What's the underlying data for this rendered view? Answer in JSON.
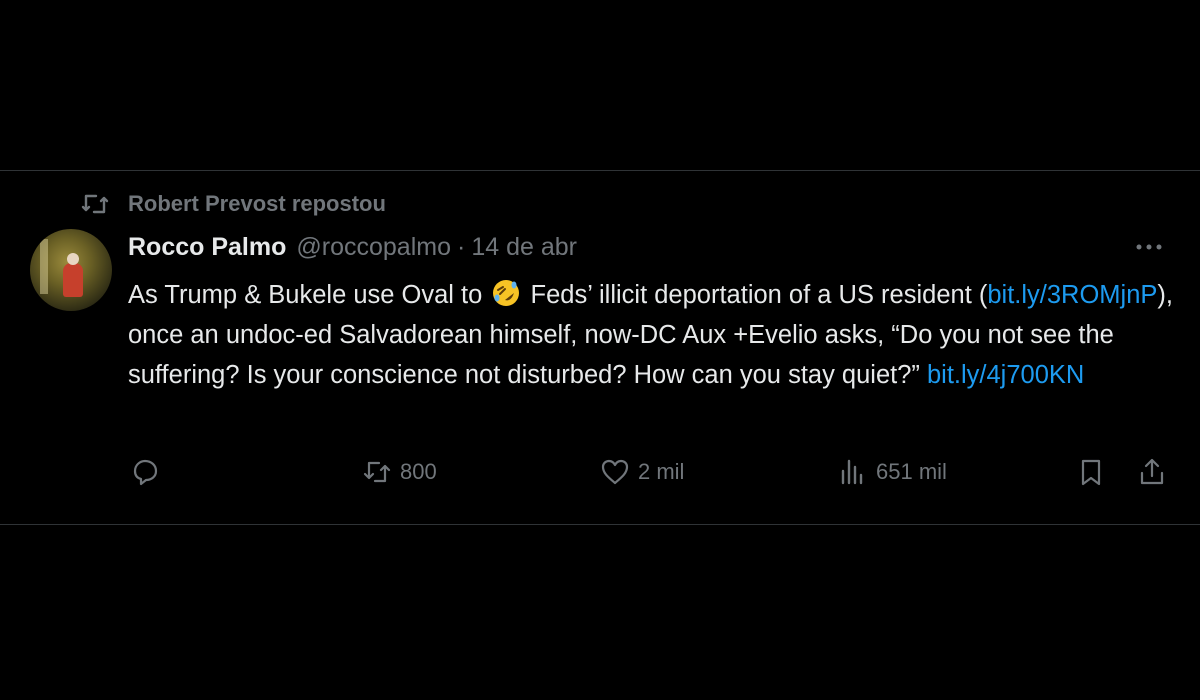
{
  "post": {
    "repost_label": "Robert Prevost repostou",
    "author_name": "Rocco Palmo",
    "author_handle": "@roccopalmo",
    "separator": "·",
    "date": "14 de abr",
    "body": {
      "part1": "As Trump & Bukele use Oval to ",
      "emoji": "rolling-on-floor-laughing-emoji",
      "part2": " Feds’ illicit deportation of a US resident (",
      "link1": "bit.ly/3ROMjnP",
      "part3": "), once an undoc-ed Salvadorean himself, now-DC Aux +Evelio asks, “Do you not see the suffering? Is your conscience not disturbed? How can you stay quiet?” ",
      "link2": "bit.ly/4j700KN"
    },
    "actions": {
      "reply_icon": "reply-icon",
      "repost_count": "800",
      "like_count": "2 mil",
      "views_count": "651 mil",
      "bookmark_icon": "bookmark-icon",
      "share_icon": "share-icon"
    }
  },
  "colors": {
    "background": "#000000",
    "text": "#e7e9ea",
    "muted": "#71767b",
    "link": "#1d9bf0",
    "divider": "#2f3336"
  }
}
